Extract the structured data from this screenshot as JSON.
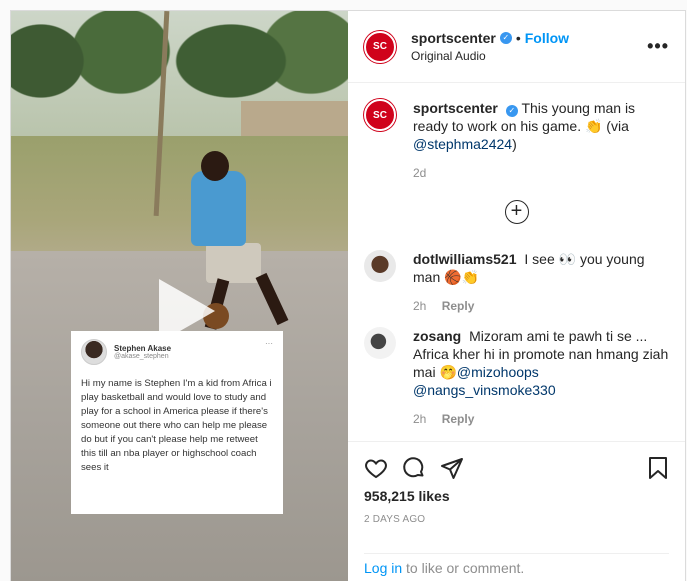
{
  "header": {
    "logo_text": "SC",
    "username": "sportscenter",
    "verified_icon": "✓",
    "separator": "•",
    "follow_label": "Follow",
    "audio_label": "Original Audio",
    "more_label": "•••"
  },
  "tweet": {
    "name": "Stephen Akase",
    "handle": "@akase_stephen",
    "menu": "···",
    "text": "Hi my name is Stephen I'm a kid from Africa i play basketball and would love to study and play for a school in America please if there's someone out there who can help me please do but if you can't please help me retweet this till an nba player or highschool coach sees it"
  },
  "caption": {
    "username": "sportscenter",
    "text": "This young man is ready to work on his game. 👏 (via ",
    "mention": "@stephma2424",
    "suffix": ")",
    "time": "2d"
  },
  "load_more_label": "+",
  "comments": [
    {
      "username": "dotlwilliams521",
      "text": "I see 👀 you young man 🏀👏",
      "time": "2h",
      "reply": "Reply"
    },
    {
      "username": "zosang",
      "text": "Mizoram ami te pawh ti se ... Africa kher hi in promote nan hmang ziah mai 🤭",
      "mention1": "@mizohoops",
      "mention2": "@nangs_vinsmoke330",
      "time": "2h",
      "reply": "Reply"
    }
  ],
  "actions": {
    "likes": "958,215 likes",
    "date": "2 DAYS AGO"
  },
  "login": {
    "link": "Log in",
    "text": " to like or comment."
  },
  "colors": {
    "brand_red": "#d0021b",
    "follow_blue": "#0095f6",
    "verified_blue": "#3897f0"
  }
}
